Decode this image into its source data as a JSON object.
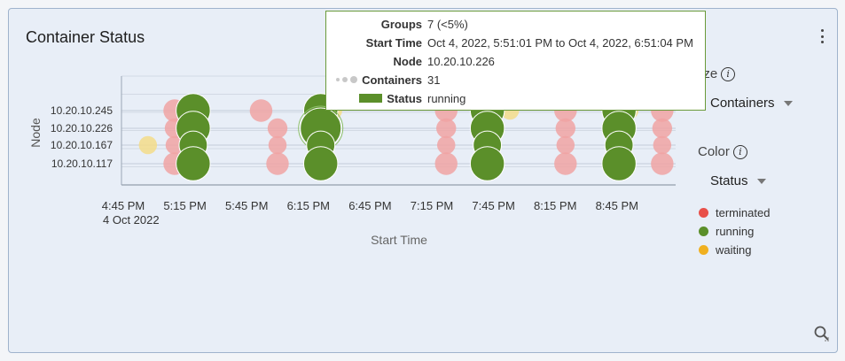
{
  "card": {
    "title": "Container Status"
  },
  "controls": {
    "size_label": "ize",
    "size_value": "Containers",
    "color_label": "Color",
    "color_value": "Status",
    "info_icon": "info-icon"
  },
  "tooltip": {
    "groups_key": "Groups",
    "groups_val": "7 (<5%)",
    "start_key": "Start Time",
    "start_val": "Oct 4, 2022, 5:51:01 PM to Oct 4, 2022, 6:51:04 PM",
    "node_key": "Node",
    "node_val": "10.20.10.226",
    "containers_key": "Containers",
    "containers_val": "31",
    "status_key": "Status",
    "status_val": "running"
  },
  "legend": [
    {
      "label": "terminated",
      "color": "#e8504a"
    },
    {
      "label": "running",
      "color": "#5b8f2a"
    },
    {
      "label": "waiting",
      "color": "#f0b020"
    }
  ],
  "chart_data": {
    "type": "scatter",
    "xlabel": "Start Time",
    "ylabel": "Node",
    "x_ticks": [
      "4:45 PM",
      "5:15 PM",
      "5:45 PM",
      "6:15 PM",
      "6:45 PM",
      "7:15 PM",
      "7:45 PM",
      "8:15 PM",
      "8:45 PM"
    ],
    "x_date_label": "4 Oct 2022",
    "y_categories": [
      "10.20.10.117",
      "10.20.10.167",
      "10.20.10.226",
      "10.20.10.245"
    ],
    "status_colors": {
      "terminated": "#f0a3a3",
      "running": "#5b8f2a",
      "waiting": "#f3dc8a"
    },
    "points": [
      {
        "x": "4:57 PM",
        "node": "10.20.10.167",
        "status": "waiting",
        "size": 2
      },
      {
        "x": "5:10 PM",
        "node": "10.20.10.245",
        "status": "terminated",
        "size": 5
      },
      {
        "x": "5:10 PM",
        "node": "10.20.10.226",
        "status": "terminated",
        "size": 3
      },
      {
        "x": "5:10 PM",
        "node": "10.20.10.167",
        "status": "terminated",
        "size": 2
      },
      {
        "x": "5:10 PM",
        "node": "10.20.10.117",
        "status": "terminated",
        "size": 5
      },
      {
        "x": "5:19 PM",
        "node": "10.20.10.245",
        "status": "running",
        "size": 14
      },
      {
        "x": "5:19 PM",
        "node": "10.20.10.226",
        "status": "running",
        "size": 14
      },
      {
        "x": "5:19 PM",
        "node": "10.20.10.167",
        "status": "running",
        "size": 7
      },
      {
        "x": "5:19 PM",
        "node": "10.20.10.117",
        "status": "running",
        "size": 14
      },
      {
        "x": "5:22 PM",
        "node": "10.20.10.245",
        "status": "waiting",
        "size": 2
      },
      {
        "x": "5:52 PM",
        "node": "10.20.10.245",
        "status": "terminated",
        "size": 5
      },
      {
        "x": "6:00 PM",
        "node": "10.20.10.226",
        "status": "terminated",
        "size": 3
      },
      {
        "x": "6:00 PM",
        "node": "10.20.10.167",
        "status": "terminated",
        "size": 2
      },
      {
        "x": "6:00 PM",
        "node": "10.20.10.117",
        "status": "terminated",
        "size": 5
      },
      {
        "x": "6:21 PM",
        "node": "10.20.10.245",
        "status": "running",
        "size": 14
      },
      {
        "x": "6:21 PM",
        "node": "10.20.10.226",
        "status": "running",
        "size": 31
      },
      {
        "x": "6:21 PM",
        "node": "10.20.10.167",
        "status": "running",
        "size": 7
      },
      {
        "x": "6:21 PM",
        "node": "10.20.10.117",
        "status": "running",
        "size": 14
      },
      {
        "x": "6:27 PM",
        "node": "10.20.10.245",
        "status": "waiting",
        "size": 2
      },
      {
        "x": "7:22 PM",
        "node": "10.20.10.245",
        "status": "terminated",
        "size": 5
      },
      {
        "x": "7:22 PM",
        "node": "10.20.10.226",
        "status": "terminated",
        "size": 3
      },
      {
        "x": "7:22 PM",
        "node": "10.20.10.167",
        "status": "terminated",
        "size": 2
      },
      {
        "x": "7:22 PM",
        "node": "10.20.10.117",
        "status": "terminated",
        "size": 5
      },
      {
        "x": "7:42 PM",
        "node": "10.20.10.245",
        "status": "running",
        "size": 14
      },
      {
        "x": "7:42 PM",
        "node": "10.20.10.226",
        "status": "running",
        "size": 14
      },
      {
        "x": "7:42 PM",
        "node": "10.20.10.167",
        "status": "running",
        "size": 7
      },
      {
        "x": "7:42 PM",
        "node": "10.20.10.117",
        "status": "running",
        "size": 14
      },
      {
        "x": "7:53 PM",
        "node": "10.20.10.245",
        "status": "waiting",
        "size": 2
      },
      {
        "x": "8:20 PM",
        "node": "10.20.10.245",
        "status": "terminated",
        "size": 5
      },
      {
        "x": "8:20 PM",
        "node": "10.20.10.226",
        "status": "terminated",
        "size": 3
      },
      {
        "x": "8:20 PM",
        "node": "10.20.10.167",
        "status": "terminated",
        "size": 2
      },
      {
        "x": "8:20 PM",
        "node": "10.20.10.117",
        "status": "terminated",
        "size": 5
      },
      {
        "x": "8:46 PM",
        "node": "10.20.10.245",
        "status": "running",
        "size": 14
      },
      {
        "x": "8:46 PM",
        "node": "10.20.10.226",
        "status": "running",
        "size": 14
      },
      {
        "x": "8:46 PM",
        "node": "10.20.10.167",
        "status": "running",
        "size": 7
      },
      {
        "x": "8:46 PM",
        "node": "10.20.10.117",
        "status": "running",
        "size": 14
      },
      {
        "x": "8:51 PM",
        "node": "10.20.10.245",
        "status": "waiting",
        "size": 2
      },
      {
        "x": "9:07 PM",
        "node": "10.20.10.245",
        "status": "terminated",
        "size": 5
      },
      {
        "x": "9:07 PM",
        "node": "10.20.10.226",
        "status": "terminated",
        "size": 3
      },
      {
        "x": "9:07 PM",
        "node": "10.20.10.167",
        "status": "terminated",
        "size": 2
      },
      {
        "x": "9:07 PM",
        "node": "10.20.10.117",
        "status": "terminated",
        "size": 5
      }
    ]
  }
}
